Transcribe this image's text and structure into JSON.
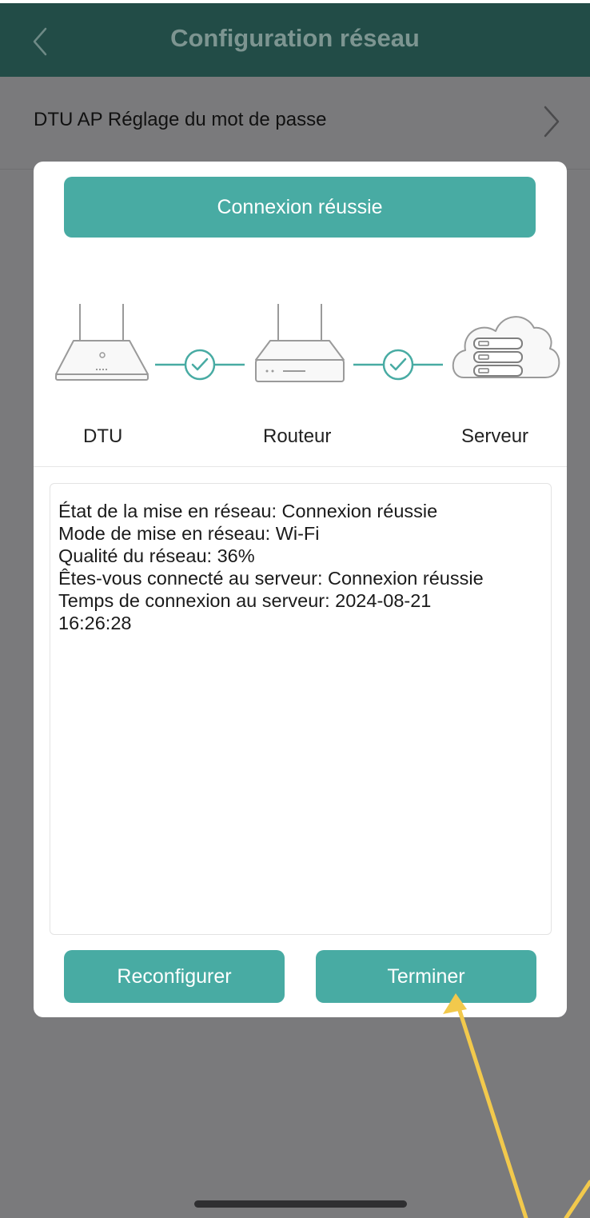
{
  "header": {
    "title": "Configuration réseau",
    "back_icon": "chevron-left-icon"
  },
  "settings_row": {
    "label": "DTU AP Réglage du mot de passe",
    "chevron_icon": "chevron-right-icon"
  },
  "dialog": {
    "status_banner": "Connexion réussie",
    "nodes": [
      {
        "label": "DTU",
        "icon": "dtu-device-icon"
      },
      {
        "label": "Routeur",
        "icon": "router-icon"
      },
      {
        "label": "Serveur",
        "icon": "cloud-server-icon"
      }
    ],
    "info_lines": [
      "État de la mise en réseau: Connexion réussie",
      "Mode de mise en réseau: Wi-Fi",
      "Qualité du réseau: 36%",
      "Êtes-vous connecté au serveur: Connexion réussie",
      "Temps de connexion au serveur: 2024-08-21\n16:26:28"
    ],
    "buttons": {
      "reconfigure": "Reconfigurer",
      "finish": "Terminer"
    }
  },
  "colors": {
    "header_bg": "#224c47",
    "accent": "#48aba3",
    "overlay": "#7a7a7c",
    "annotation_arrow": "#f2c94c"
  }
}
